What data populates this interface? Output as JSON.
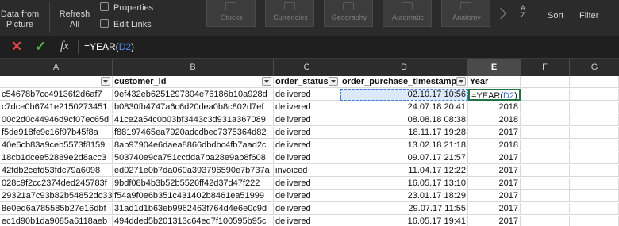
{
  "ribbon": {
    "data_from_picture": "Data from\nPicture",
    "refresh_all": "Refresh\nAll",
    "properties": "Properties",
    "edit_links": "Edit Links",
    "data_types": [
      "Stocks",
      "Currencies",
      "Geography",
      "Automatic",
      "Anatomy"
    ],
    "sort": "Sort",
    "filter": "Filter"
  },
  "formula_bar": {
    "fx": "fx",
    "formula_prefix": "=YEAR(",
    "formula_ref": "D2",
    "formula_suffix": ")"
  },
  "columns": [
    "A",
    "B",
    "C",
    "D",
    "E",
    "F",
    "G"
  ],
  "active_column": "E",
  "headers": {
    "a": "",
    "b": "customer_id",
    "c": "order_status",
    "d": "order_purchase_timestamp",
    "e": "Year"
  },
  "edit_cell": {
    "prefix": "=YEAR(",
    "ref": "D2",
    "suffix": ")"
  },
  "rows": [
    {
      "a": "c54678b7cc49136f2d6af7",
      "b": "9ef432eb6251297304e76186b10a928d",
      "c": "delivered",
      "d": "02.10.17 10:56",
      "e": ""
    },
    {
      "a": "c7dce0b6741e2150273451",
      "b": "b0830fb4747a6c6d20dea0b8c802d7ef",
      "c": "delivered",
      "d": "24.07.18 20:41",
      "e": "2018"
    },
    {
      "a": "00c2d0c44946d9cf07ec65d",
      "b": "41ce2a54c0b03bf3443c3d931a367089",
      "c": "delivered",
      "d": "08.08.18 08:38",
      "e": "2018"
    },
    {
      "a": "f5de918fe9c16f97b45f8a",
      "b": "f88197465ea7920adcdbec7375364d82",
      "c": "delivered",
      "d": "18.11.17 19:28",
      "e": "2017"
    },
    {
      "a": "40e6cb83a9ceb5573f8159",
      "b": "8ab97904e6daea8866dbdbc4fb7aad2c",
      "c": "delivered",
      "d": "13.02.18 21:18",
      "e": "2018"
    },
    {
      "a": "18cb1dcee52889e2d8acc3",
      "b": "503740e9ca751ccdda7ba28e9ab8f608",
      "c": "delivered",
      "d": "09.07.17 21:57",
      "e": "2017"
    },
    {
      "a": "42fdb2cefd53fdc79a6098",
      "b": "ed0271e0b7da060a393796590e7b737a",
      "c": "invoiced",
      "d": "11.04.17 12:22",
      "e": "2017"
    },
    {
      "a": "028c9f2cc2374ded245783f",
      "b": "9bdf08b4b3b52b5526ff42d37d47f222",
      "c": "delivered",
      "d": "16.05.17 13:10",
      "e": "2017"
    },
    {
      "a": "29321a7c93b82b54852dc33",
      "b": "f54a9f0e6b351c431402b8461ea51999",
      "c": "delivered",
      "d": "23.01.17 18:29",
      "e": "2017"
    },
    {
      "a": "8e0ed6a785585b27e16dbf",
      "b": "31ad1d1b63eb9962463f764d4e6e0c9d",
      "c": "delivered",
      "d": "29.07.17 11:55",
      "e": "2017"
    },
    {
      "a": "ec1d90b1da9085a6118aeb",
      "b": "494dded5b201313c64ed7f100595b95c",
      "c": "delivered",
      "d": "16.05.17 19:41",
      "e": "2017"
    }
  ]
}
